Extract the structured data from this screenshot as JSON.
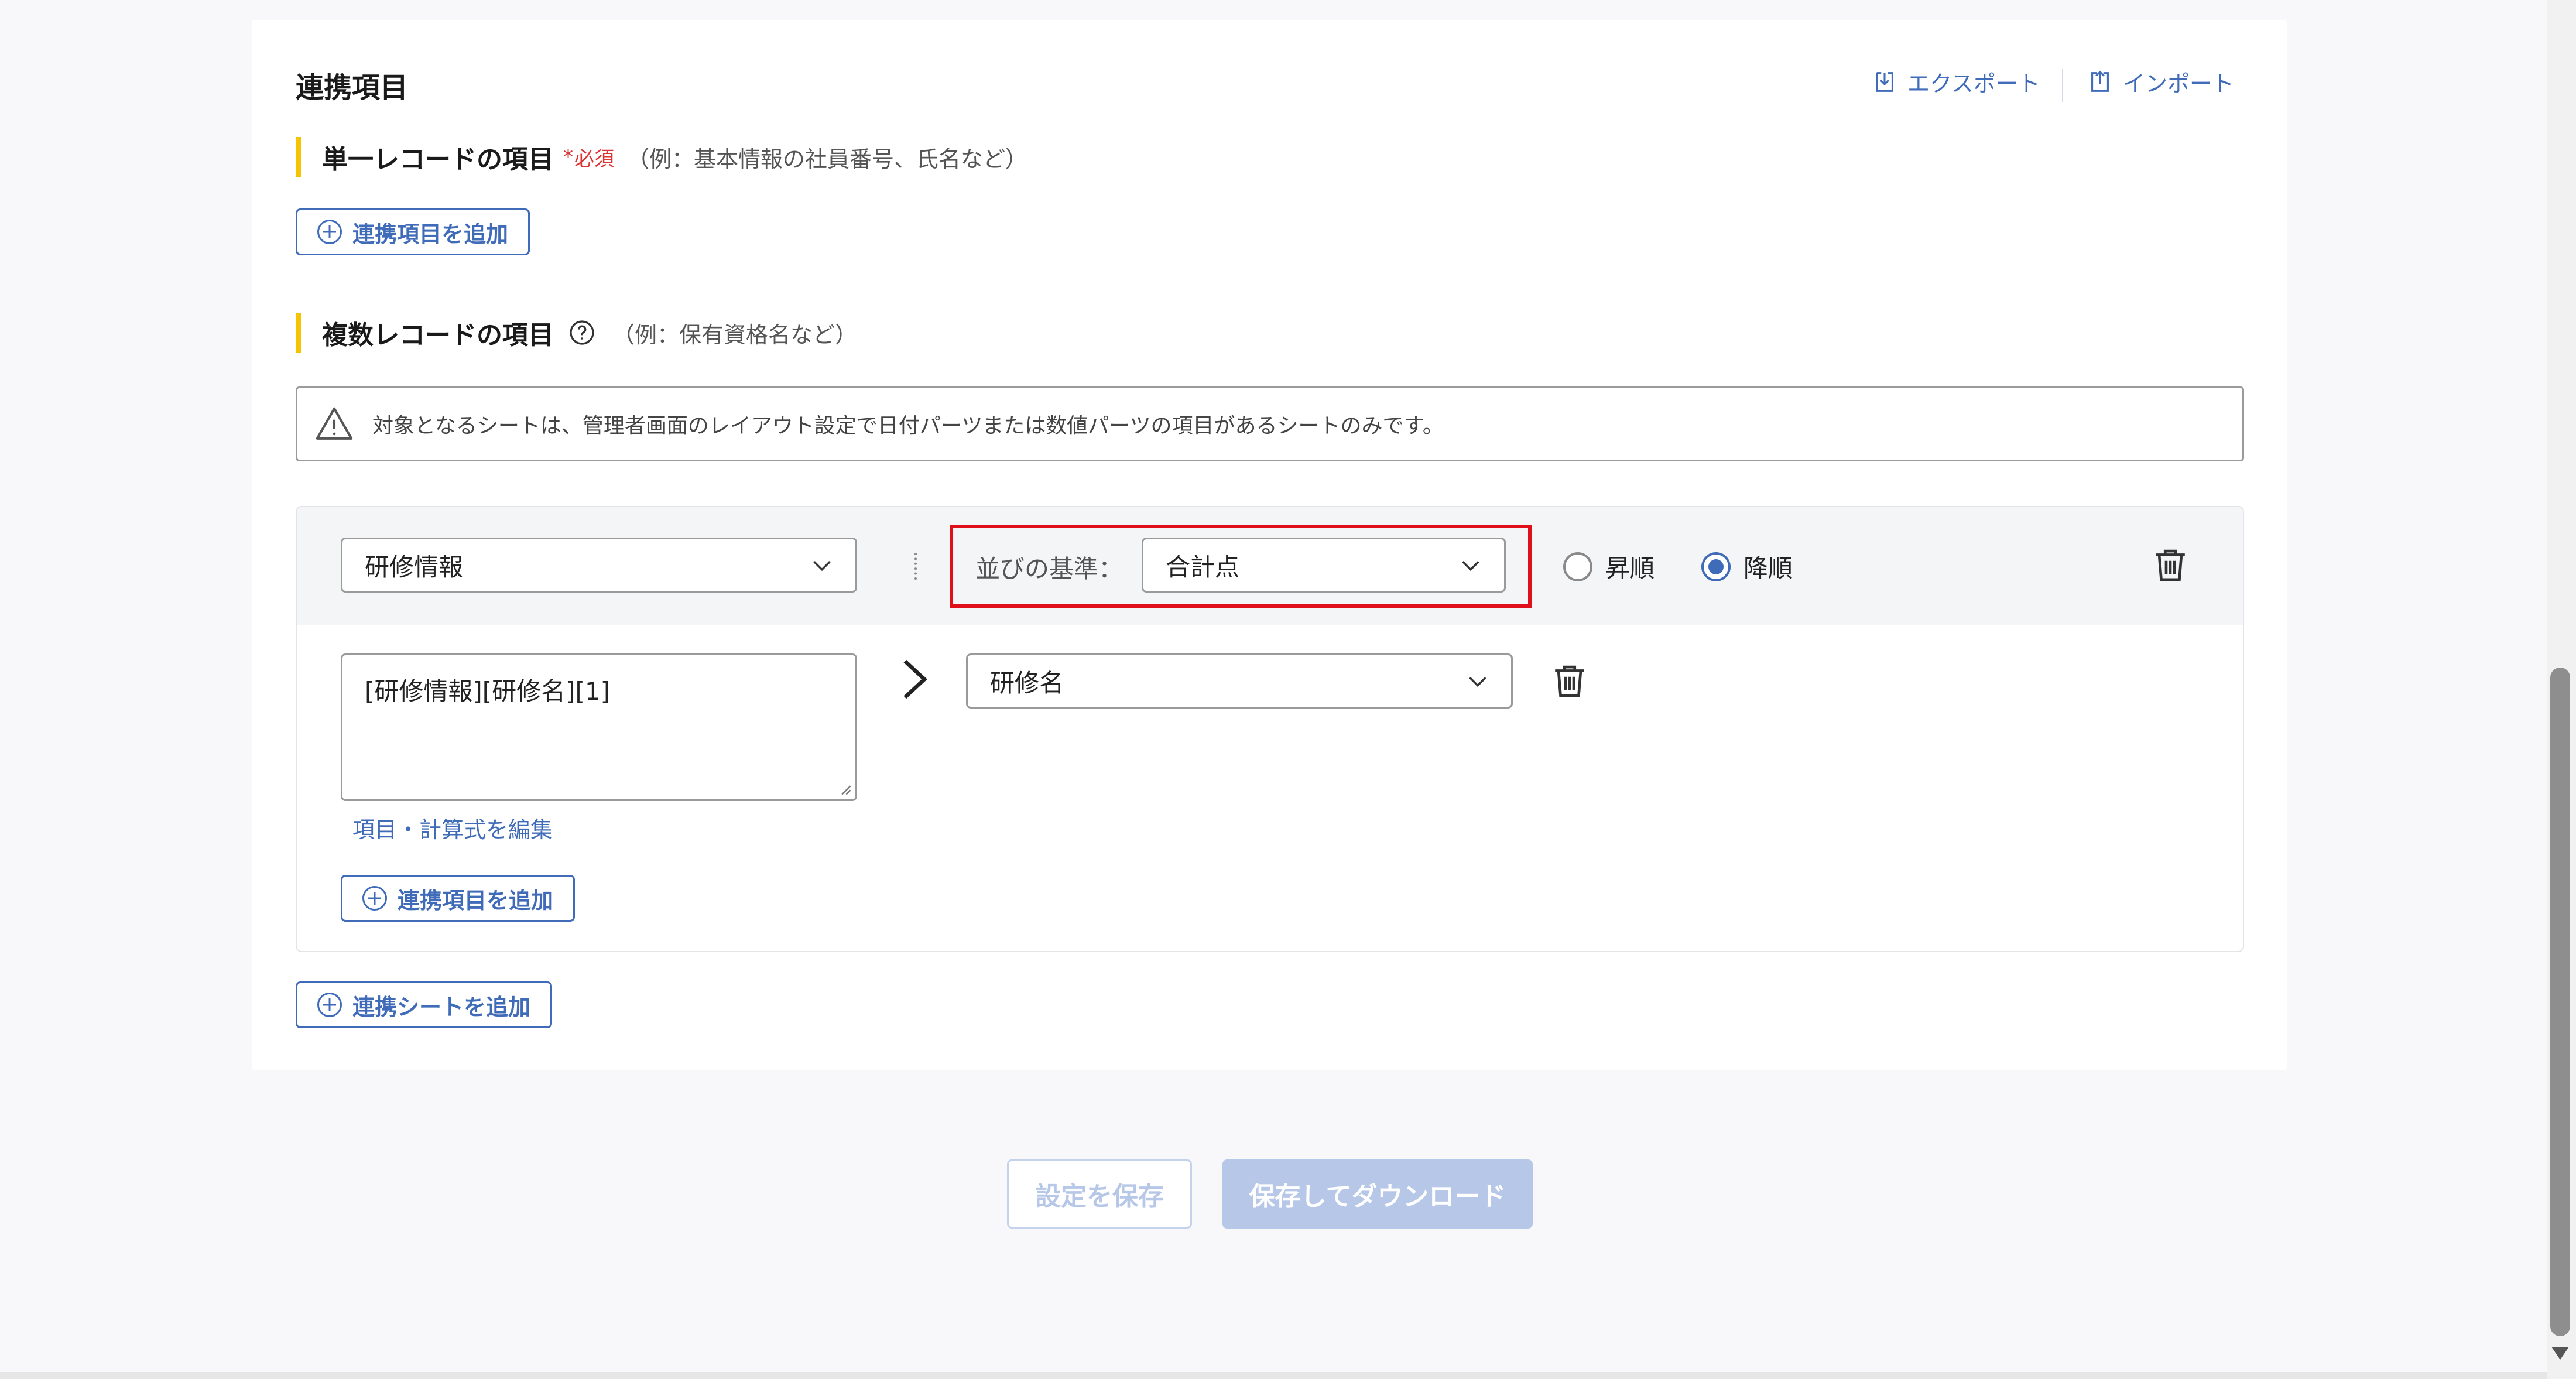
{
  "header": {
    "title": "連携項目",
    "export_label": "エクスポート",
    "import_label": "インポート"
  },
  "single_record": {
    "title": "単一レコードの項目",
    "required_mark": "*",
    "required_label": "必須",
    "example": "（例：基本情報の社員番号、氏名など）",
    "add_button": "連携項目を追加"
  },
  "multi_record": {
    "title": "複数レコードの項目",
    "help_icon": "question-circle-icon",
    "example": "（例：保有資格名など）",
    "notice": "対象となるシートは、管理者画面のレイアウト設定で日付パーツまたは数値パーツの項目があるシートのみです。",
    "sheet": {
      "sheet_select": "研修情報",
      "sort_label": "並びの基準：",
      "sort_select": "合計点",
      "order_asc": "昇順",
      "order_desc": "降順",
      "selected_order": "降順",
      "item_formula": "[研修情報][研修名][1]",
      "item_target": "研修名",
      "edit_link": "項目・計算式を編集",
      "add_item_button": "連携項目を追加"
    },
    "add_sheet_button": "連携シートを追加"
  },
  "footer": {
    "save_button": "設定を保存",
    "save_download_button": "保存してダウンロード"
  },
  "colors": {
    "accent": "#3f6bb8",
    "section_marker": "#f5c400",
    "highlight_frame": "#e0101a",
    "disabled_button": "#b7c7e8"
  }
}
